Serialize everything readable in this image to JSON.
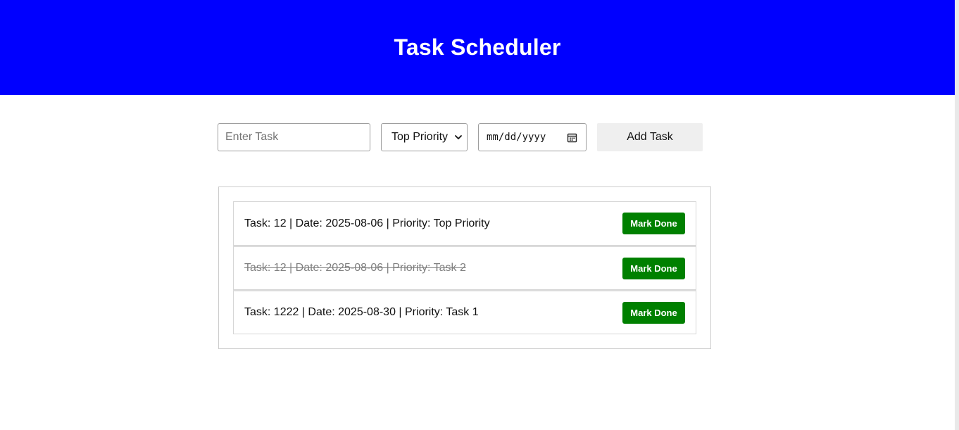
{
  "header": {
    "title": "Task Scheduler",
    "background_color": "#0000ff"
  },
  "form": {
    "task_placeholder": "Enter Task",
    "task_value": "",
    "priority_selected": "Top Priority",
    "date_placeholder": "mm/dd/yyyy",
    "add_label": "Add Task"
  },
  "tasks": [
    {
      "text": "Task: 12 | Date: 2025-08-06 | Priority: Top Priority",
      "done": false,
      "button_label": "Mark Done"
    },
    {
      "text": "Task: 12 | Date: 2025-08-06 | Priority: Task 2",
      "done": true,
      "button_label": "Mark Done"
    },
    {
      "text": "Task: 1222 | Date: 2025-08-30 | Priority: Task 1",
      "done": false,
      "button_label": "Mark Done"
    }
  ],
  "colors": {
    "done_button": "#008000",
    "completed_text": "#808080"
  }
}
